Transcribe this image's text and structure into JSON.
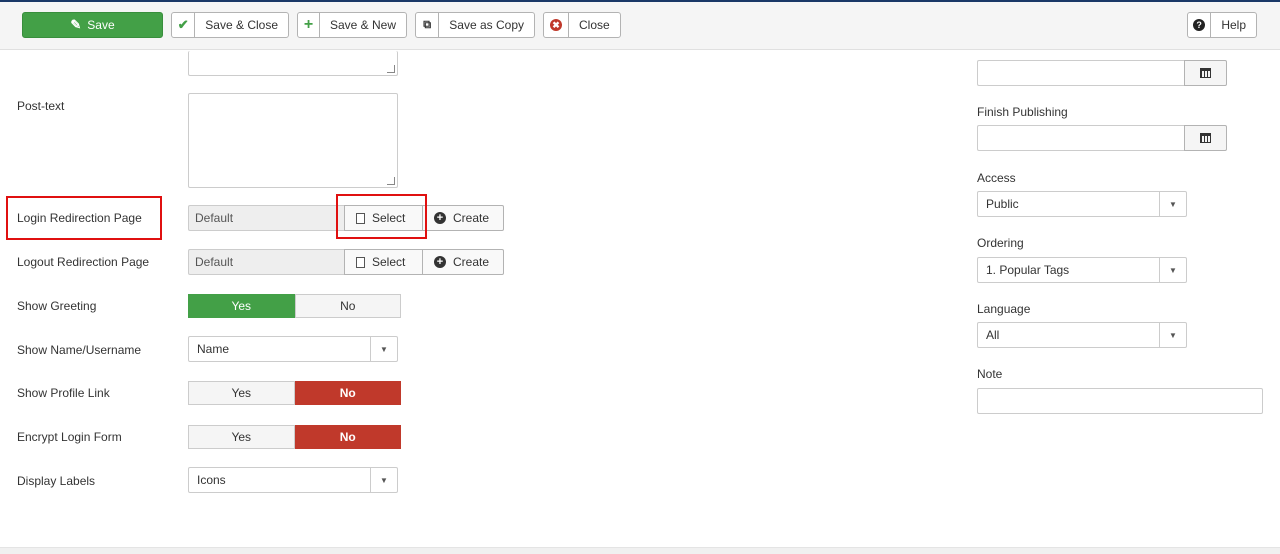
{
  "toolbar": {
    "save": "Save",
    "save_close": "Save & Close",
    "save_new": "Save & New",
    "save_copy": "Save as Copy",
    "close": "Close",
    "help": "Help"
  },
  "fields": {
    "post_text_label": "Post-text",
    "login_redirect_label": "Login Redirection Page",
    "login_redirect_value": "Default",
    "logout_redirect_label": "Logout Redirection Page",
    "logout_redirect_value": "Default",
    "select_label": "Select",
    "create_label": "Create",
    "show_greeting_label": "Show Greeting",
    "show_name_label": "Show Name/Username",
    "show_name_value": "Name",
    "show_profile_label": "Show Profile Link",
    "encrypt_label": "Encrypt Login Form",
    "display_labels_label": "Display Labels",
    "display_labels_value": "Icons",
    "yes": "Yes",
    "no": "No"
  },
  "toggles": {
    "show_greeting": "Yes",
    "show_profile_link": "No",
    "encrypt_login_form": "No"
  },
  "sidebar": {
    "finish_publishing_label": "Finish Publishing",
    "access_label": "Access",
    "access_value": "Public",
    "ordering_label": "Ordering",
    "ordering_value": "1. Popular Tags",
    "language_label": "Language",
    "language_value": "All",
    "note_label": "Note"
  },
  "icons": {
    "save": "edit-icon",
    "save_close": "check-icon",
    "save_new": "plus-icon",
    "save_copy": "copy-icon",
    "close": "close-circle-icon",
    "help": "question-circle-icon"
  },
  "colors": {
    "save_green": "#43a047",
    "toggle_yes": "#43a047",
    "toggle_no": "#c0392b",
    "highlight": "#e01010"
  }
}
